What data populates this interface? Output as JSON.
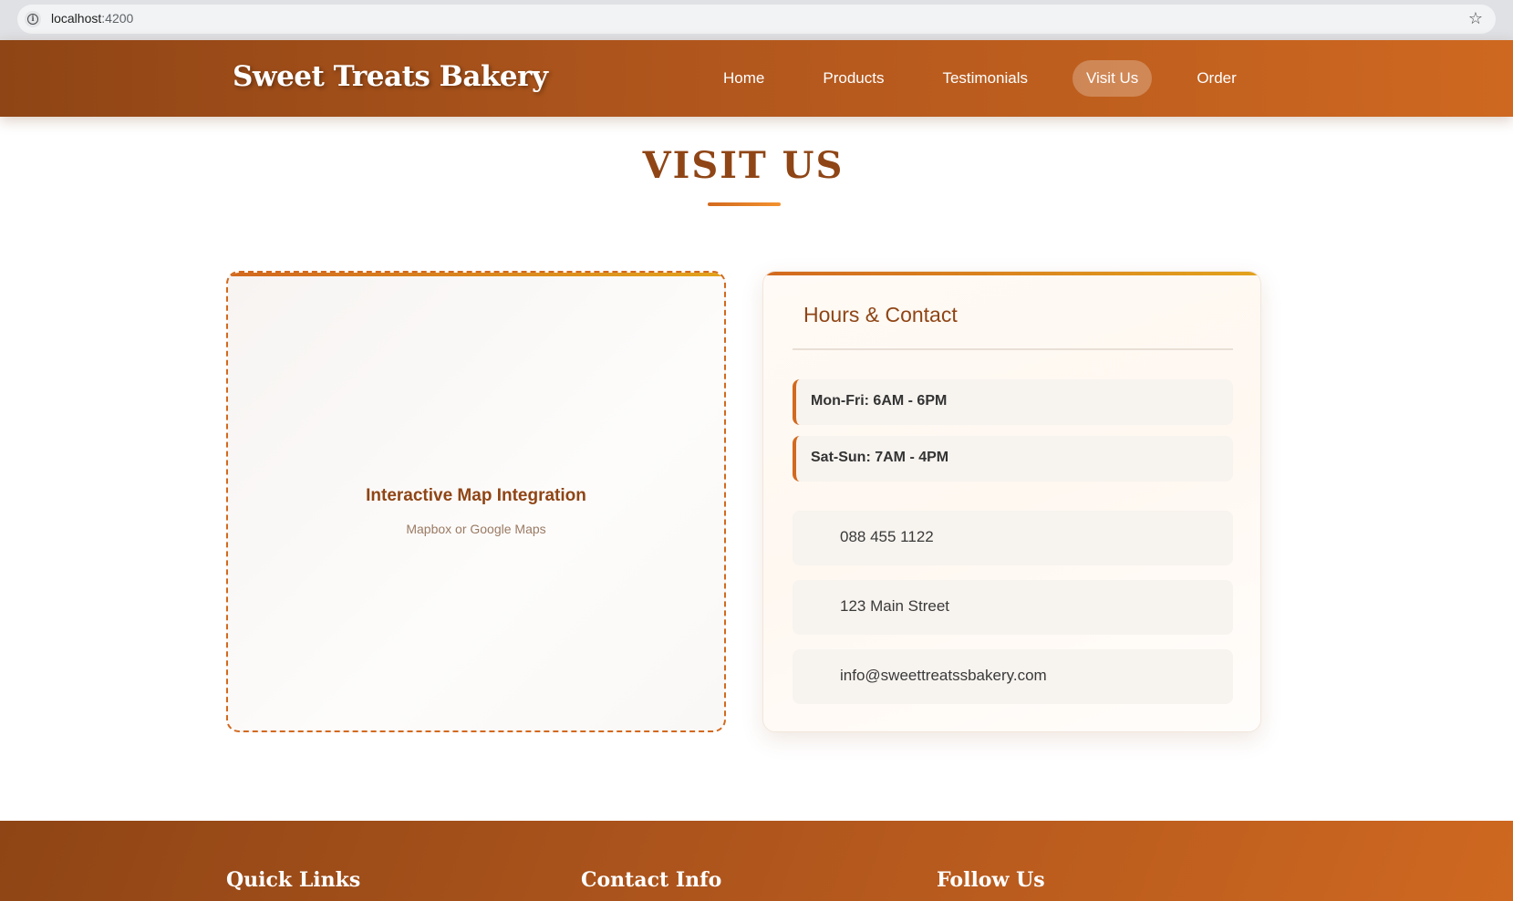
{
  "browser": {
    "url_host": "localhost",
    "url_port": ":4200",
    "icons": {
      "info": "info-icon",
      "bookmark": "star-icon"
    }
  },
  "header": {
    "brand": "Sweet Treats Bakery",
    "nav": [
      {
        "label": "Home",
        "active": false
      },
      {
        "label": "Products",
        "active": false
      },
      {
        "label": "Testimonials",
        "active": false
      },
      {
        "label": "Visit Us",
        "active": true
      },
      {
        "label": "Order",
        "active": false
      }
    ],
    "gradient": [
      "#8f4515",
      "#ce6820"
    ]
  },
  "section": {
    "title": "VISIT US",
    "accent_color": "#d2691e"
  },
  "map": {
    "title": "Interactive Map Integration",
    "subtitle": "Mapbox or Google Maps"
  },
  "contact_card": {
    "heading": "Hours & Contact",
    "hours": [
      "Mon-Fri: 6AM - 6PM",
      "Sat-Sun: 7AM - 4PM"
    ],
    "contacts": [
      {
        "icon": "phone-icon",
        "text": "088 455 1122"
      },
      {
        "icon": "location-icon",
        "text": "123 Main Street"
      },
      {
        "icon": "email-icon",
        "text": "info@sweettreatssbakery.com"
      }
    ]
  },
  "footer": {
    "headings": [
      "Quick Links",
      "Contact Info",
      "Follow Us"
    ]
  }
}
